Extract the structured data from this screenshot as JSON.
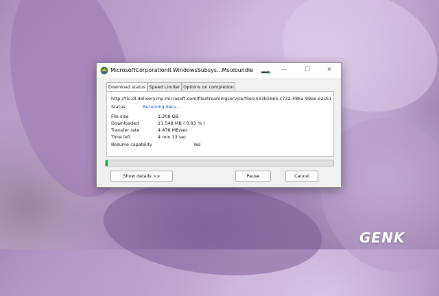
{
  "window": {
    "title": "MicrosoftCorporationII.WindowsSubsys...Msixbundle",
    "minimize_symbol": "—",
    "maximize_symbol": "☐",
    "close_symbol": "✕",
    "app_icon": "idm-app-icon"
  },
  "tabs": [
    {
      "label": "Download status",
      "active": true
    },
    {
      "label": "Speed Limiter",
      "active": false
    },
    {
      "label": "Options on completion",
      "active": false
    }
  ],
  "download": {
    "url": "http://tlu.dl.delivery.mp.microsoft.com/filestreamingservice/files/433b1665-c732-486a-99ee-e2c61",
    "status_label": "Status",
    "status_value": "Receiving data...",
    "file_size_label": "File size",
    "file_size_value": "1.208  GB",
    "downloaded_label": "Downloaded",
    "downloaded_value": "11.548  MB  ( 0.93 % )",
    "transfer_rate_label": "Transfer rate",
    "transfer_rate_value": "4.478  MB/sec",
    "time_left_label": "Time left",
    "time_left_value": "4 min 33 sec",
    "resume_label": "Resume capability",
    "resume_value": "Yes",
    "progress_percent": 0.93
  },
  "buttons": {
    "show_details": "Show details >>",
    "pause": "Pause",
    "cancel": "Cancel"
  },
  "watermark": "GENK",
  "colors": {
    "status_text": "#1a4fd6",
    "progress_fill": "#06b025"
  }
}
